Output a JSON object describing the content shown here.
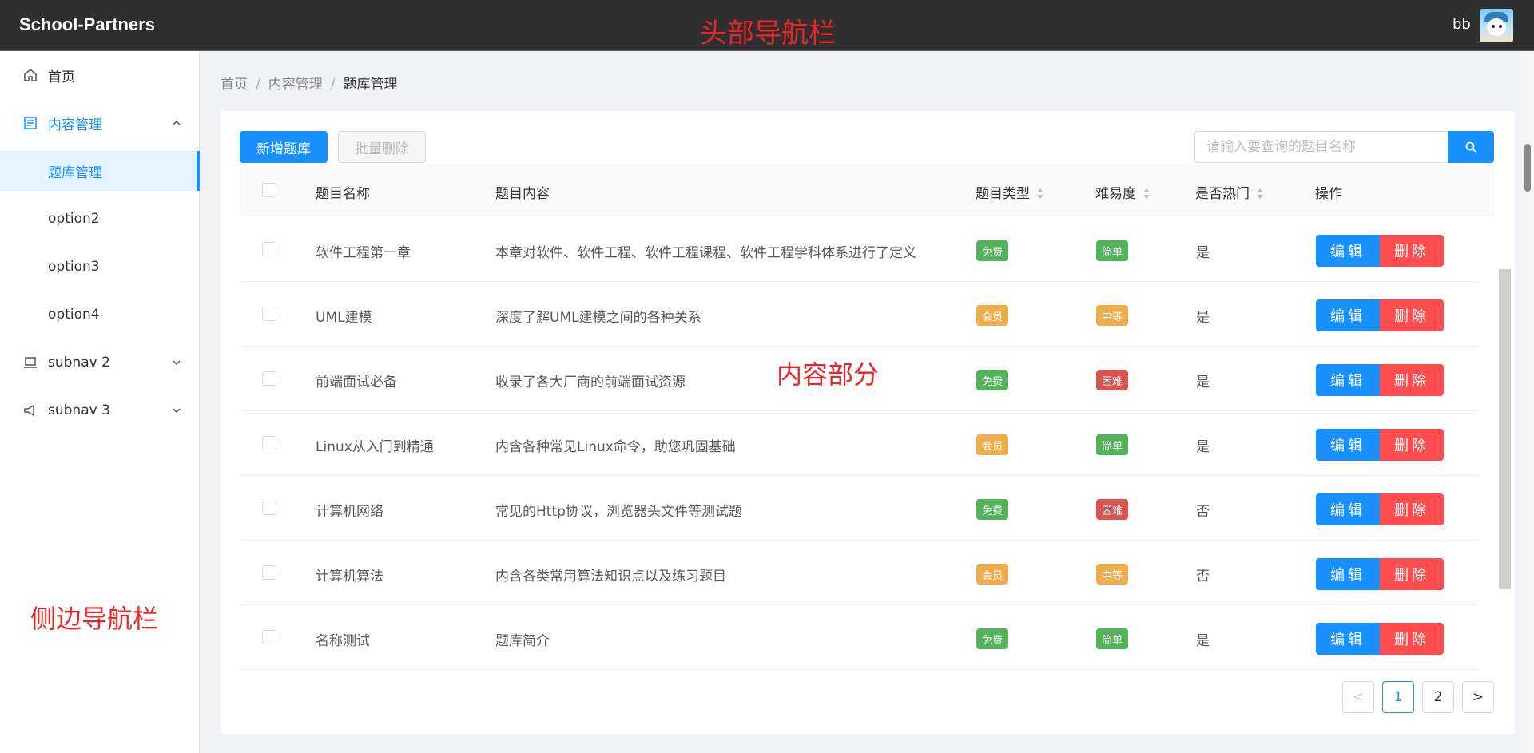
{
  "header": {
    "app_title": "School-Partners",
    "annotation": "头部导航栏",
    "username": "bb"
  },
  "sidebar": {
    "items": [
      {
        "label": "首页",
        "icon": "home-icon"
      },
      {
        "label": "内容管理",
        "icon": "content-icon"
      },
      {
        "label": "题库管理"
      },
      {
        "label": "option2"
      },
      {
        "label": "option3"
      },
      {
        "label": "option4"
      },
      {
        "label": "subnav 2",
        "icon": "laptop-icon"
      },
      {
        "label": "subnav 3",
        "icon": "notification-icon"
      }
    ],
    "annotation": "侧边导航栏"
  },
  "breadcrumb": [
    "首页",
    "内容管理",
    "题库管理"
  ],
  "toolbar": {
    "add_label": "新增题库",
    "batch_delete_label": "批量删除",
    "search_placeholder": "请输入要查询的题目名称"
  },
  "table": {
    "columns": [
      "题目名称",
      "题目内容",
      "题目类型",
      "难易度",
      "是否热门",
      "操作"
    ],
    "rows": [
      {
        "name": "软件工程第一章",
        "content": "本章对软件、软件工程、软件工程课程、软件工程学科体系进行了定义",
        "type": "免费",
        "difficulty": "简单",
        "hot": "是"
      },
      {
        "name": "UML建模",
        "content": "深度了解UML建模之间的各种关系",
        "type": "会员",
        "difficulty": "中等",
        "hot": "是"
      },
      {
        "name": "前端面试必备",
        "content": "收录了各大厂商的前端面试资源",
        "type": "免费",
        "difficulty": "困难",
        "hot": "是"
      },
      {
        "name": "Linux从入门到精通",
        "content": "内含各种常见Linux命令，助您巩固基础",
        "type": "会员",
        "difficulty": "简单",
        "hot": "是"
      },
      {
        "name": "计算机网络",
        "content": "常见的Http协议，浏览器头文件等测试题",
        "type": "免费",
        "difficulty": "困难",
        "hot": "否"
      },
      {
        "name": "计算机算法",
        "content": "内含各类常用算法知识点以及练习题目",
        "type": "会员",
        "difficulty": "中等",
        "hot": "否"
      },
      {
        "name": "名称测试",
        "content": "题库简介",
        "type": "免费",
        "difficulty": "简单",
        "hot": "是"
      }
    ],
    "edit_label": "编辑",
    "delete_label": "删除"
  },
  "content_annotation": "内容部分",
  "pagination": {
    "prev": "<",
    "pages": [
      "1",
      "2"
    ],
    "current": "1",
    "next": ">"
  },
  "colors": {
    "primary": "#1890ff",
    "danger": "#ff4d4f",
    "free": "#52b35a",
    "member": "#f0ad4e",
    "easy": "#52b35a",
    "medium": "#f0ad4e",
    "hard": "#d9534f",
    "annotation": "#e8262a"
  }
}
